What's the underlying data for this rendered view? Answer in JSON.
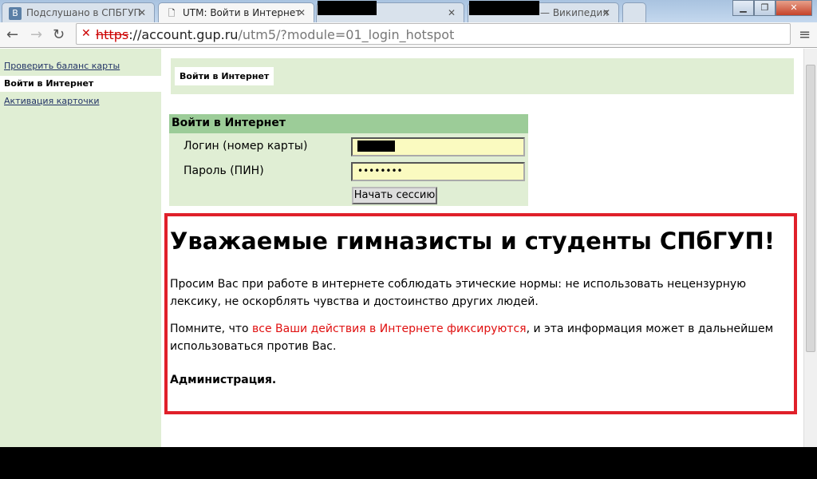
{
  "browser": {
    "tabs": [
      {
        "label": "Подслушано в СПБГУП",
        "icon": "vk-icon",
        "active": false
      },
      {
        "label": "UTM: Войти в Интернет",
        "icon": "page-icon",
        "active": true
      },
      {
        "label": "",
        "icon": "",
        "active": false
      },
      {
        "label": "— Википедия",
        "icon": "",
        "active": false
      }
    ],
    "url_scheme": "https",
    "url_host": "://account.gup.ru",
    "url_path": "/utm5/?module=01_login_hotspot"
  },
  "sidebar": {
    "items": [
      {
        "label": "Проверить баланс карты",
        "active": false
      },
      {
        "label": "Войти в Интернет",
        "active": true
      },
      {
        "label": "Активация карточки",
        "active": false
      }
    ]
  },
  "header": {
    "title": "Войти в Интернет"
  },
  "form": {
    "title": "Войти в Интернет",
    "login_label": "Логин (номер карты)",
    "password_label": "Пароль (ПИН)",
    "password_value": "••••••••",
    "submit": "Начать сессию"
  },
  "notice": {
    "heading": "Уважаемые гимназисты и студенты СПбГУП!",
    "p1": "Просим Вас при работе в интернете соблюдать этические нормы: не использовать нецензурную лексику, не оскорблять чувства и достоинство других людей.",
    "p2_start": "Помните, что ",
    "p2_red": "все Ваши действия в Интернете фиксируются",
    "p2_end": ", и эта информация может в дальнейшем использоваться против Вас.",
    "signature": "Администрация."
  }
}
